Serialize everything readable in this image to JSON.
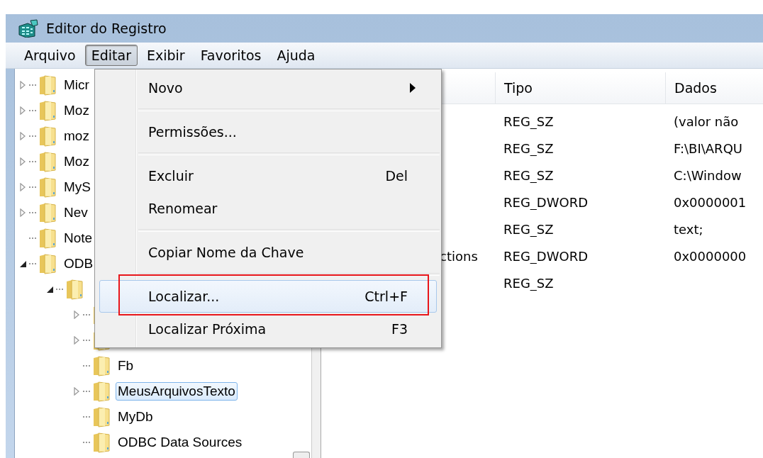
{
  "window": {
    "title": "Editor do Registro"
  },
  "menubar": [
    {
      "label": "Arquivo",
      "selected": false
    },
    {
      "label": "Editar",
      "selected": true
    },
    {
      "label": "Exibir",
      "selected": false
    },
    {
      "label": "Favoritos",
      "selected": false
    },
    {
      "label": "Ajuda",
      "selected": false
    }
  ],
  "tree": [
    {
      "label": "Micr",
      "kind": "branch",
      "expanded": false,
      "selected": false
    },
    {
      "label": "Moz",
      "kind": "branch",
      "expanded": false,
      "selected": false
    },
    {
      "label": "moz",
      "kind": "branch",
      "expanded": false,
      "selected": false
    },
    {
      "label": "Moz",
      "kind": "branch",
      "expanded": false,
      "selected": false
    },
    {
      "label": "MyS",
      "kind": "branch",
      "expanded": false,
      "selected": false
    },
    {
      "label": "Nev",
      "kind": "branch",
      "expanded": false,
      "selected": false
    },
    {
      "label": "Note",
      "kind": "leaf",
      "selected": false
    },
    {
      "label": "ODB",
      "kind": "branch",
      "expanded": true,
      "selected": false,
      "children": [
        {
          "kind": "branch",
          "expanded": true,
          "children": [
            {
              "kind": "branch",
              "expanded": false
            },
            {
              "kind": "branch",
              "expanded": false
            },
            {
              "label": "Fb",
              "kind": "leaf",
              "selected": false
            },
            {
              "label": "MeusArquivosTexto",
              "kind": "branch",
              "expanded": false,
              "selected": true
            },
            {
              "label": "MyDb",
              "kind": "leaf",
              "selected": false
            },
            {
              "label": "ODBC Data Sources",
              "kind": "leaf",
              "selected": false
            }
          ]
        }
      ]
    }
  ],
  "list": {
    "columns": [
      "Tipo",
      "Dados"
    ],
    "rows": [
      {
        "type": "REG_SZ",
        "data": "(valor não"
      },
      {
        "type": "REG_SZ",
        "data": "F:\\BI\\ARQU"
      },
      {
        "type": "REG_SZ",
        "data": "C:\\Window"
      },
      {
        "type": "REG_DWORD",
        "data": "0x0000001"
      },
      {
        "type": "REG_SZ",
        "data": "text;"
      },
      {
        "column_1": "ctions",
        "type": "REG_DWORD",
        "data": "0x0000000"
      },
      {
        "type": "REG_SZ"
      }
    ]
  },
  "context_menu": [
    {
      "kind": "item",
      "label": "Novo",
      "submenu": true,
      "selected": false,
      "annotated": false
    },
    {
      "kind": "separator"
    },
    {
      "kind": "item",
      "label": "Permissões...",
      "selected": false,
      "annotated": false
    },
    {
      "kind": "separator"
    },
    {
      "kind": "item",
      "label": "Excluir",
      "shortcut": "Del",
      "selected": false,
      "annotated": false
    },
    {
      "kind": "item",
      "label": "Renomear",
      "selected": false,
      "annotated": false
    },
    {
      "kind": "separator"
    },
    {
      "kind": "item",
      "label": "Copiar Nome da Chave",
      "selected": false,
      "annotated": false
    },
    {
      "kind": "separator"
    },
    {
      "kind": "item",
      "label": "Localizar...",
      "shortcut": "Ctrl+F",
      "selected": true,
      "annotated": true
    },
    {
      "kind": "item",
      "label": "Localizar Próxima",
      "shortcut": "F3",
      "selected": false,
      "annotated": false
    }
  ]
}
